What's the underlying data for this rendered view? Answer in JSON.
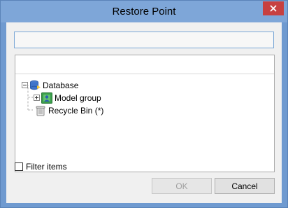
{
  "window": {
    "title": "Restore Point"
  },
  "path_field": {
    "value": ""
  },
  "tree": {
    "nodes": [
      {
        "label": "Database",
        "icon": "database-icon",
        "expanded": true
      },
      {
        "label": "Model group",
        "icon": "model-group-icon",
        "expanded": false
      },
      {
        "label": "Recycle Bin (*)",
        "icon": "recycle-bin-icon"
      }
    ]
  },
  "filter": {
    "label": "Filter items",
    "checked": false
  },
  "buttons": {
    "ok_label": "OK",
    "ok_enabled": false,
    "cancel_label": "Cancel"
  },
  "colors": {
    "frame": "#6f9ad0",
    "close_button": "#c74040",
    "focus_border": "#7aa7d6"
  }
}
